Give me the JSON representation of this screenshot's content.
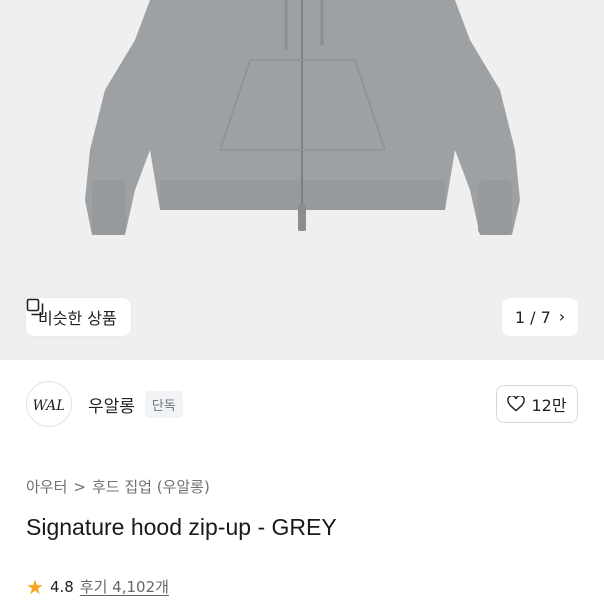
{
  "image_area": {
    "similar_label": "비슷한 상품",
    "similar_icon": "similar-products-icon",
    "pager_text": "1 / 7",
    "pager_icon": "chevron-right-icon"
  },
  "brand": {
    "logo_text": "WAL",
    "name": "우알롱",
    "badge": "단독",
    "likes": "12만",
    "like_icon": "heart-icon"
  },
  "breadcrumb": {
    "category": "아우터",
    "separator": ">",
    "subcategory": "후드 집업 (우알롱)"
  },
  "product": {
    "title": "Signature hood zip-up - GREY",
    "rating": "4.8",
    "review_label": "후기 4,102개",
    "star_color": "#f5a623"
  }
}
